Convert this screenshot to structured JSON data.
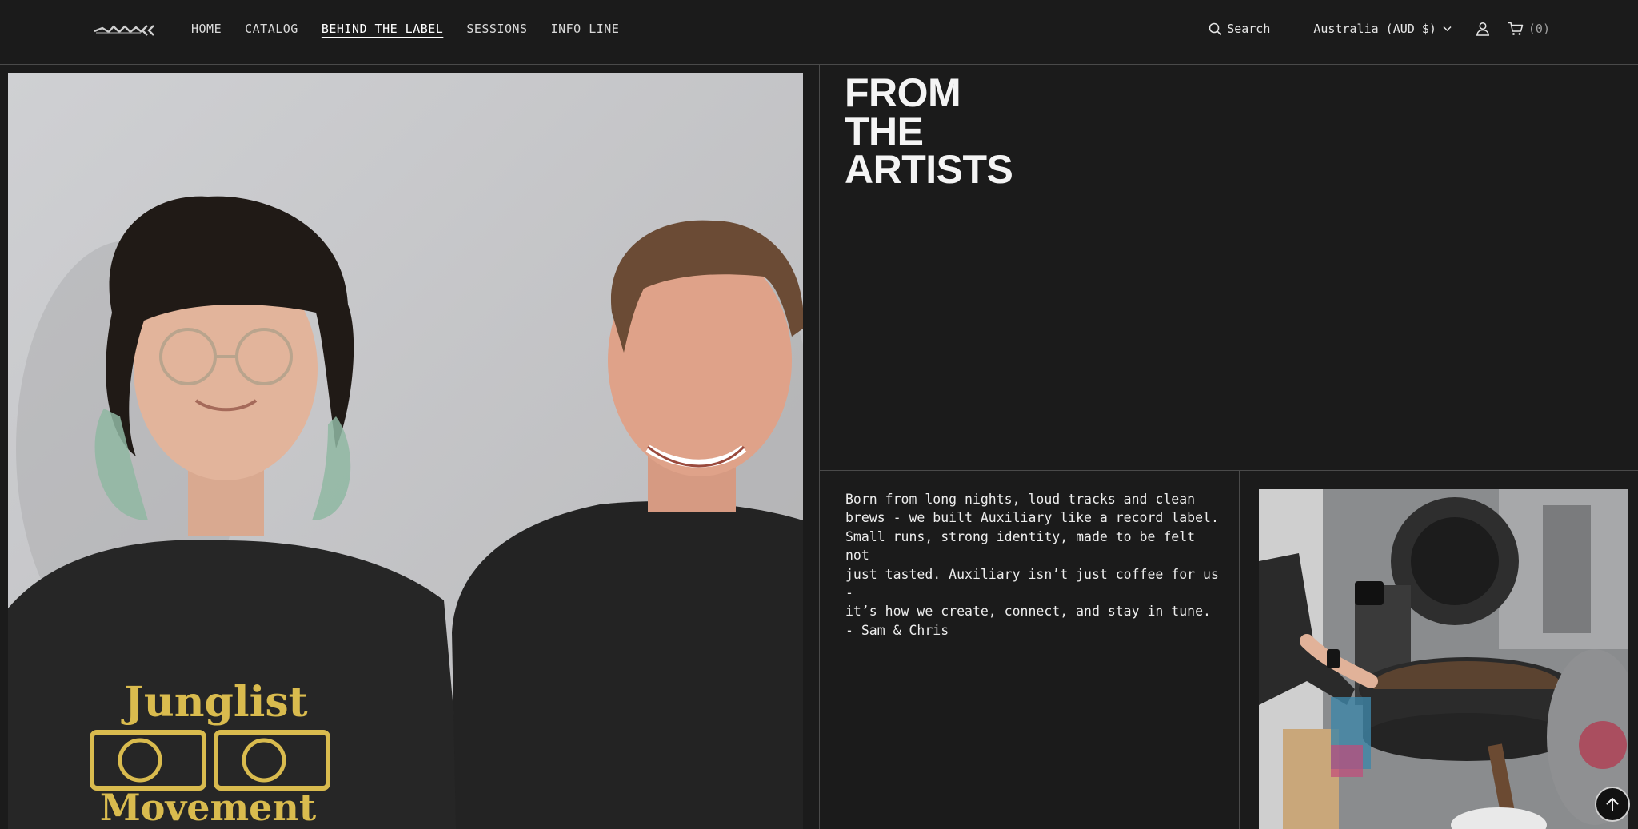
{
  "header": {
    "nav": [
      {
        "label": "HOME"
      },
      {
        "label": "CATALOG"
      },
      {
        "label": "BEHIND THE LABEL",
        "active": true
      },
      {
        "label": "SESSIONS"
      },
      {
        "label": "INFO LINE"
      }
    ],
    "search_label": "Search",
    "country_label": "Australia (AUD $)",
    "cart_count": "(0)",
    "icons": {
      "logo": "brand-logo",
      "search": "search-icon",
      "country": "chevron-down-icon",
      "account": "user-icon",
      "cart": "cart-icon"
    }
  },
  "hero": {
    "title_lines": [
      "FROM",
      "THE",
      "ARTISTS"
    ],
    "story": "Born from long nights, loud tracks and clean\nbrews - we built Auxiliary like a record label.\nSmall runs, strong identity, made to be felt not\njust tasted. Auxiliary isn’t just coffee for us -\nit’s how we create, connect, and stay in tune.\n- Sam & Chris",
    "left_photo": {
      "shirt_text_top": "Junglist",
      "shirt_text_bottom": "Movement"
    }
  },
  "back_to_top_icon": "arrow-up-icon",
  "colors": {
    "background": "#1b1b1b",
    "divider": "#4a4a4a",
    "text": "#e6e6e6"
  }
}
